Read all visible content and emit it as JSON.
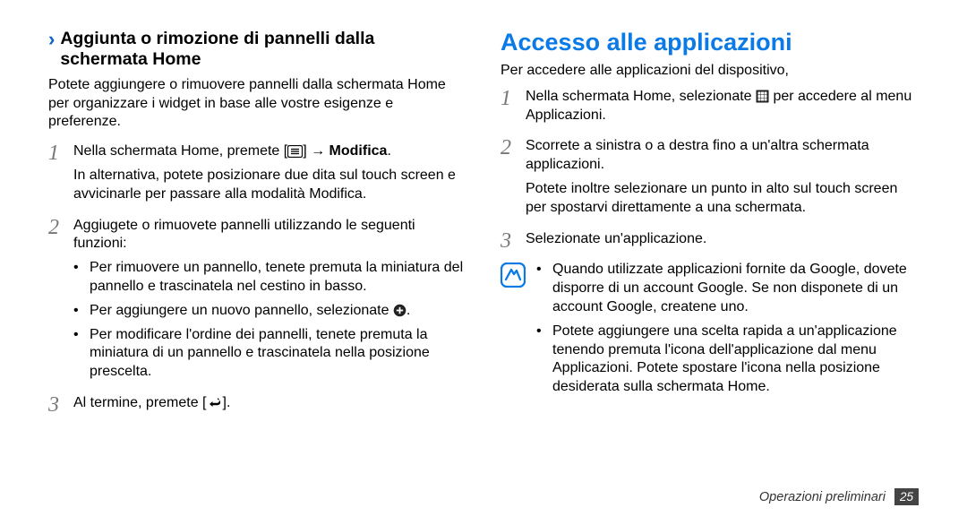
{
  "left": {
    "heading": "Aggiunta o rimozione di pannelli dalla schermata Home",
    "intro": "Potete aggiungere o rimuovere pannelli dalla schermata Home per organizzare i widget in base alle vostre esigenze e preferenze.",
    "steps": [
      {
        "num": "1",
        "line1_a": "Nella schermata Home, premete [",
        "line1_b": "] → ",
        "line1_bold": "Modifica",
        "line1_c": ".",
        "line2": "In alternativa, potete posizionare due dita sul touch screen e avvicinarle per passare alla modalità Modifica."
      },
      {
        "num": "2",
        "line1": "Aggiugete o rimuovete pannelli utilizzando le seguenti funzioni:",
        "bullets": [
          {
            "a": "Per rimuovere un pannello, tenete premuta la miniatura del pannello e trascinatela nel cestino in basso."
          },
          {
            "a": "Per aggiungere un nuovo pannello, selezionate ",
            "icon": "plus-circle",
            "b": "."
          },
          {
            "a": "Per modificare l'ordine dei pannelli, tenete premuta la miniatura di un pannello e trascinatela nella posizione prescelta."
          }
        ]
      },
      {
        "num": "3",
        "line1_a": "Al termine, premete [",
        "line1_b": "].",
        "icon": "back"
      }
    ]
  },
  "right": {
    "heading": "Accesso alle applicazioni",
    "intro": "Per accedere alle applicazioni del dispositivo,",
    "steps": [
      {
        "num": "1",
        "a": "Nella schermata Home, selezionate ",
        "icon": "apps-grid",
        "b": " per accedere al menu Applicazioni."
      },
      {
        "num": "2",
        "a": "Scorrete a sinistra o a destra fino a un'altra schermata applicazioni.",
        "b": "Potete inoltre selezionare un punto in alto sul touch screen per spostarvi direttamente a una schermata."
      },
      {
        "num": "3",
        "a": "Selezionate un'applicazione."
      }
    ],
    "note_bullets": [
      "Quando utilizzate applicazioni fornite da Google, dovete disporre di un account Google. Se non disponete di un account Google, createne uno.",
      "Potete aggiungere una scelta rapida a un'applicazione tenendo premuta l'icona dell'applicazione dal menu Applicazioni. Potete spostare l'icona nella posizione desiderata sulla schermata Home."
    ]
  },
  "footer": {
    "label": "Operazioni preliminari",
    "page": "25"
  }
}
